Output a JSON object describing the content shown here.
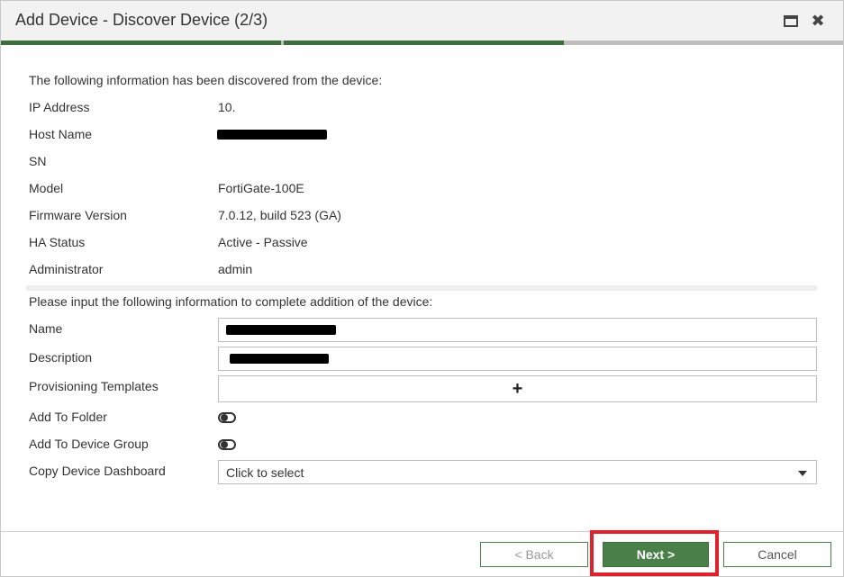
{
  "dialog": {
    "title": "Add Device - Discover Device (2/3)",
    "icons": {
      "maximize": "maximize-icon",
      "close": "close-icon"
    },
    "step": {
      "current": 2,
      "total": 3
    }
  },
  "discovered": {
    "intro": "The following information has been discovered from the device:",
    "fields": [
      {
        "label": "IP Address",
        "value": "10."
      },
      {
        "label": "Host Name",
        "value": ""
      },
      {
        "label": "SN",
        "value": ""
      },
      {
        "label": "Model",
        "value": "FortiGate-100E"
      },
      {
        "label": "Firmware Version",
        "value": "7.0.12, build 523 (GA)"
      },
      {
        "label": "HA Status",
        "value": "Active - Passive"
      },
      {
        "label": "Administrator",
        "value": "admin"
      }
    ]
  },
  "form": {
    "intro": "Please input the following information to complete addition of the device:",
    "name_label": "Name",
    "description_label": "Description",
    "provisioning_label": "Provisioning Templates",
    "add_to_folder_label": "Add To Folder",
    "add_to_device_group_label": "Add To Device Group",
    "copy_dashboard_label": "Copy Device Dashboard",
    "copy_dashboard_placeholder": "Click to select"
  },
  "footer": {
    "back_label": "< Back",
    "next_label": "Next >",
    "cancel_label": "Cancel"
  },
  "colors": {
    "accent_green": "#4a7f4a",
    "progress_done": "#3e6e3e",
    "progress_remaining": "#bdbdbd",
    "highlight_red": "#e0202a"
  }
}
